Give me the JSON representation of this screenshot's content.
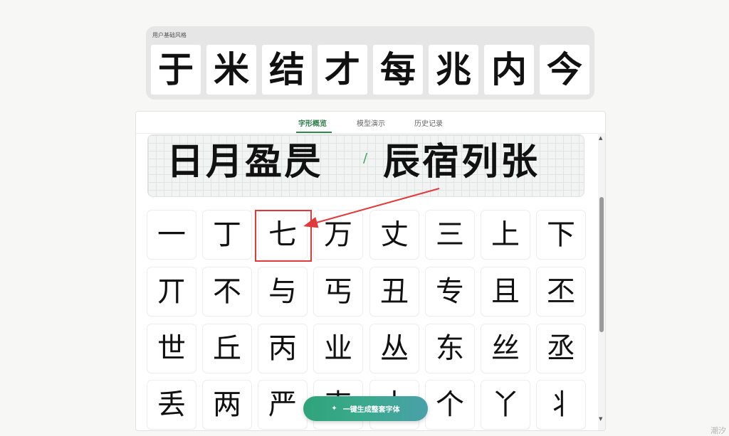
{
  "base_style": {
    "title": "用户基础风格",
    "chars": [
      "于",
      "米",
      "结",
      "才",
      "每",
      "兆",
      "内",
      "今"
    ]
  },
  "tabs": [
    {
      "label": "字形概览",
      "active": true
    },
    {
      "label": "模型演示",
      "active": false
    },
    {
      "label": "历史记录",
      "active": false
    }
  ],
  "preview": {
    "left_text": "日月盈昃",
    "separator": "/",
    "right_text": "辰宿列张"
  },
  "glyphs": [
    [
      "一",
      "丁",
      "七",
      "万",
      "丈",
      "三",
      "上",
      "下"
    ],
    [
      "丌",
      "不",
      "与",
      "丐",
      "丑",
      "专",
      "且",
      "丕"
    ],
    [
      "世",
      "丘",
      "丙",
      "业",
      "丛",
      "东",
      "丝",
      "丞"
    ],
    [
      "丢",
      "两",
      "严",
      "丧",
      "丨",
      "个",
      "丫",
      "丬"
    ]
  ],
  "generate_button": {
    "icon": "sparkle-icon",
    "label": "一键生成整套字体"
  },
  "scrollbar": {
    "up": "▲",
    "down": "▼"
  },
  "watermark": "潮汐",
  "colors": {
    "accent_green": "#2f8a4e",
    "annotation_red": "#e03a3a"
  }
}
